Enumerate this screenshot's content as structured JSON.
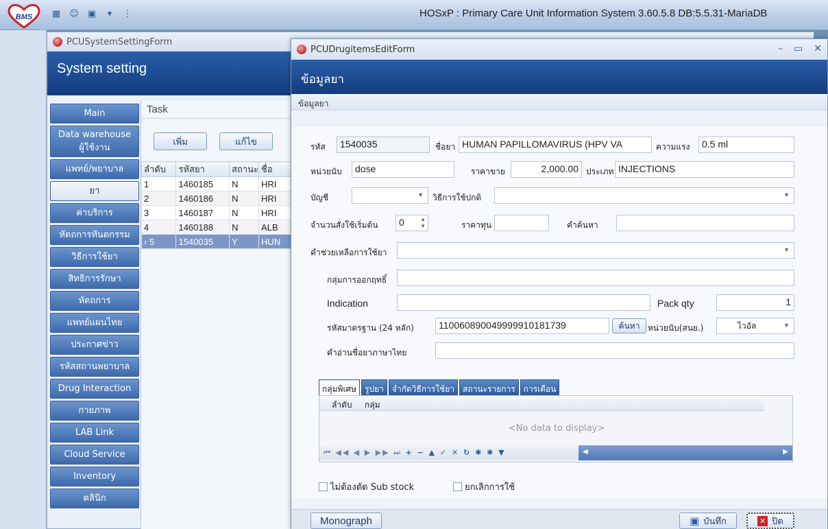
{
  "app": {
    "title": "HOSxP : Primary Care Unit Information System 3.60.5.8 DB:5.5.31-MariaDB",
    "logo_text": "BMS"
  },
  "system_form": {
    "window_title": "PCUSystemSettingForm",
    "header": "System setting",
    "menu": [
      "Main",
      "Data warehouse",
      "ผู้ใช้งาน",
      "แพทย์/พยาบาล",
      "ยา",
      "ค่าบริการ",
      "หัตถการทันตกรรม",
      "วิธีการใช้ยา",
      "สิทธิการรักษา",
      "หัตถการ",
      "แพทย์แผนไทย",
      "ประกาศข่าว",
      "รหัสสถานพยาบาล",
      "Drug Interaction",
      "กายภาพ",
      "LAB Link",
      "Cloud Service",
      "Inventory",
      "คลินิก"
    ],
    "task_label": "Task",
    "add_button": "เพิ่ม",
    "edit_button": "แก้ไข",
    "columns": [
      "ลำดับ",
      "รหัสยา",
      "สถานะ",
      "ชื่อ"
    ],
    "rows": [
      [
        "1",
        "1460185",
        "N",
        "HRI"
      ],
      [
        "2",
        "1460186",
        "N",
        "HRI"
      ],
      [
        "3",
        "1460187",
        "N",
        "HRI"
      ],
      [
        "4",
        "1460188",
        "N",
        "ALB"
      ],
      [
        "5",
        "1540035",
        "Y",
        "HUN"
      ]
    ],
    "selected_marker": "›"
  },
  "drug_form": {
    "window_title": "PCUDrugitemsEditForm",
    "header": "ข้อมูลยา",
    "group_title": "ข้อมูลยา",
    "fields": {
      "code_label": "รหัส",
      "code_value": "1540035",
      "name_label": "ชื่อยา",
      "name_value": "HUMAN PAPILLOMAVIRUS (HPV VA",
      "strength_label": "ความแรง",
      "strength_value": "0.5 ml",
      "unit_label": "หน่วยนับ",
      "unit_value": "dose",
      "price_label": "ราคาขาย",
      "price_value": "2,000.00",
      "type_label": "ประเภท",
      "type_value": "INJECTIONS",
      "account_label": "บัญชี",
      "account_value": "",
      "usage_label": "วิธีการใช้ปกติ",
      "usage_value": "",
      "initial_qty_label": "จำนวนสั่งใช้เริ่มต้น",
      "initial_qty_value": "0",
      "cost_label": "ราคาทุน",
      "cost_value": "",
      "search_label": "คำค้นหา",
      "search_value": "",
      "help_label": "คำช่วยเหลือการใช้ยา",
      "help_value": "",
      "drug_group_label": "กลุ่มการออกฤทธิ์",
      "drug_group_value": "",
      "indication_label": "Indication",
      "indication_value": "",
      "pack_label": "Pack qty",
      "pack_value": "1",
      "std_code_label": "รหัสมาตรฐาน (24 หลัก)",
      "std_code_value": "110060890049999910181739",
      "search_button": "ค้นหา",
      "std_unit_label": "หน่วยนับ(สนย.)",
      "std_unit_value": "ไวอัล",
      "thai_name_label": "คำอ่านชื่อยาภาษาไทย",
      "thai_name_value": ""
    },
    "tabs": [
      "กลุ่มพิเศษ",
      "รูปยา",
      "จำกัดวิธีการใช้ยา",
      "สถานะรายการ",
      "การเตือน"
    ],
    "grid_columns": [
      "ลำดับ",
      "กลุ่ม"
    ],
    "no_data": "<No data to display>",
    "nav_glyphs": "⏮ ◀◀ ◀ ▶ ▶▶ ⏭",
    "nav_actions": "+ − ▲ ✓ ✕ ↻ ✱ ✱ ▼",
    "checkbox_substock": "ไม่ต้องตัด Sub stock",
    "checkbox_cancel": "ยกเลิกการใช้",
    "monograph_button": "Monograph",
    "save_button": "บันทึก",
    "close_button": "ปิด"
  },
  "colors": {
    "header_blue": "#1f4f96",
    "accent": "#2a5ea8",
    "selected_row": "#7d96c9"
  }
}
